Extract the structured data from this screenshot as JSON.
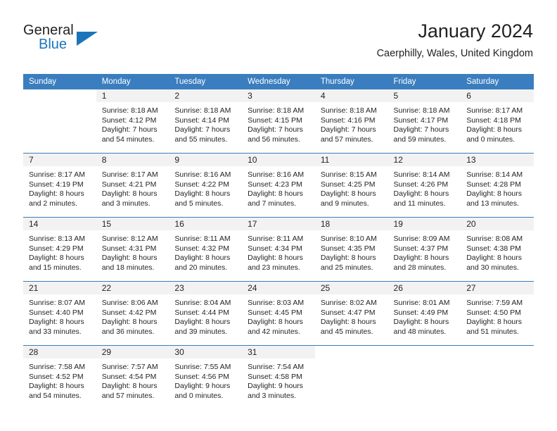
{
  "brand": {
    "name_part1": "General",
    "name_part2": "Blue",
    "accent_color": "#1b75bb"
  },
  "header": {
    "title": "January 2024",
    "subtitle": "Caerphilly, Wales, United Kingdom",
    "header_bg_color": "#3a7ebf",
    "daynum_band_color": "#f2f2f2"
  },
  "weekday_headers": [
    "Sunday",
    "Monday",
    "Tuesday",
    "Wednesday",
    "Thursday",
    "Friday",
    "Saturday"
  ],
  "labels": {
    "sunrise_prefix": "Sunrise:",
    "sunset_prefix": "Sunset:",
    "daylight_prefix": "Daylight:"
  },
  "weeks": [
    [
      {
        "day": "",
        "empty": true,
        "sunrise": "",
        "sunset": "",
        "daylight_line1": "",
        "daylight_line2": ""
      },
      {
        "day": "1",
        "empty": false,
        "sunrise": "Sunrise: 8:18 AM",
        "sunset": "Sunset: 4:12 PM",
        "daylight_line1": "Daylight: 7 hours",
        "daylight_line2": "and 54 minutes."
      },
      {
        "day": "2",
        "empty": false,
        "sunrise": "Sunrise: 8:18 AM",
        "sunset": "Sunset: 4:14 PM",
        "daylight_line1": "Daylight: 7 hours",
        "daylight_line2": "and 55 minutes."
      },
      {
        "day": "3",
        "empty": false,
        "sunrise": "Sunrise: 8:18 AM",
        "sunset": "Sunset: 4:15 PM",
        "daylight_line1": "Daylight: 7 hours",
        "daylight_line2": "and 56 minutes."
      },
      {
        "day": "4",
        "empty": false,
        "sunrise": "Sunrise: 8:18 AM",
        "sunset": "Sunset: 4:16 PM",
        "daylight_line1": "Daylight: 7 hours",
        "daylight_line2": "and 57 minutes."
      },
      {
        "day": "5",
        "empty": false,
        "sunrise": "Sunrise: 8:18 AM",
        "sunset": "Sunset: 4:17 PM",
        "daylight_line1": "Daylight: 7 hours",
        "daylight_line2": "and 59 minutes."
      },
      {
        "day": "6",
        "empty": false,
        "sunrise": "Sunrise: 8:17 AM",
        "sunset": "Sunset: 4:18 PM",
        "daylight_line1": "Daylight: 8 hours",
        "daylight_line2": "and 0 minutes."
      }
    ],
    [
      {
        "day": "7",
        "empty": false,
        "sunrise": "Sunrise: 8:17 AM",
        "sunset": "Sunset: 4:19 PM",
        "daylight_line1": "Daylight: 8 hours",
        "daylight_line2": "and 2 minutes."
      },
      {
        "day": "8",
        "empty": false,
        "sunrise": "Sunrise: 8:17 AM",
        "sunset": "Sunset: 4:21 PM",
        "daylight_line1": "Daylight: 8 hours",
        "daylight_line2": "and 3 minutes."
      },
      {
        "day": "9",
        "empty": false,
        "sunrise": "Sunrise: 8:16 AM",
        "sunset": "Sunset: 4:22 PM",
        "daylight_line1": "Daylight: 8 hours",
        "daylight_line2": "and 5 minutes."
      },
      {
        "day": "10",
        "empty": false,
        "sunrise": "Sunrise: 8:16 AM",
        "sunset": "Sunset: 4:23 PM",
        "daylight_line1": "Daylight: 8 hours",
        "daylight_line2": "and 7 minutes."
      },
      {
        "day": "11",
        "empty": false,
        "sunrise": "Sunrise: 8:15 AM",
        "sunset": "Sunset: 4:25 PM",
        "daylight_line1": "Daylight: 8 hours",
        "daylight_line2": "and 9 minutes."
      },
      {
        "day": "12",
        "empty": false,
        "sunrise": "Sunrise: 8:14 AM",
        "sunset": "Sunset: 4:26 PM",
        "daylight_line1": "Daylight: 8 hours",
        "daylight_line2": "and 11 minutes."
      },
      {
        "day": "13",
        "empty": false,
        "sunrise": "Sunrise: 8:14 AM",
        "sunset": "Sunset: 4:28 PM",
        "daylight_line1": "Daylight: 8 hours",
        "daylight_line2": "and 13 minutes."
      }
    ],
    [
      {
        "day": "14",
        "empty": false,
        "sunrise": "Sunrise: 8:13 AM",
        "sunset": "Sunset: 4:29 PM",
        "daylight_line1": "Daylight: 8 hours",
        "daylight_line2": "and 15 minutes."
      },
      {
        "day": "15",
        "empty": false,
        "sunrise": "Sunrise: 8:12 AM",
        "sunset": "Sunset: 4:31 PM",
        "daylight_line1": "Daylight: 8 hours",
        "daylight_line2": "and 18 minutes."
      },
      {
        "day": "16",
        "empty": false,
        "sunrise": "Sunrise: 8:11 AM",
        "sunset": "Sunset: 4:32 PM",
        "daylight_line1": "Daylight: 8 hours",
        "daylight_line2": "and 20 minutes."
      },
      {
        "day": "17",
        "empty": false,
        "sunrise": "Sunrise: 8:11 AM",
        "sunset": "Sunset: 4:34 PM",
        "daylight_line1": "Daylight: 8 hours",
        "daylight_line2": "and 23 minutes."
      },
      {
        "day": "18",
        "empty": false,
        "sunrise": "Sunrise: 8:10 AM",
        "sunset": "Sunset: 4:35 PM",
        "daylight_line1": "Daylight: 8 hours",
        "daylight_line2": "and 25 minutes."
      },
      {
        "day": "19",
        "empty": false,
        "sunrise": "Sunrise: 8:09 AM",
        "sunset": "Sunset: 4:37 PM",
        "daylight_line1": "Daylight: 8 hours",
        "daylight_line2": "and 28 minutes."
      },
      {
        "day": "20",
        "empty": false,
        "sunrise": "Sunrise: 8:08 AM",
        "sunset": "Sunset: 4:38 PM",
        "daylight_line1": "Daylight: 8 hours",
        "daylight_line2": "and 30 minutes."
      }
    ],
    [
      {
        "day": "21",
        "empty": false,
        "sunrise": "Sunrise: 8:07 AM",
        "sunset": "Sunset: 4:40 PM",
        "daylight_line1": "Daylight: 8 hours",
        "daylight_line2": "and 33 minutes."
      },
      {
        "day": "22",
        "empty": false,
        "sunrise": "Sunrise: 8:06 AM",
        "sunset": "Sunset: 4:42 PM",
        "daylight_line1": "Daylight: 8 hours",
        "daylight_line2": "and 36 minutes."
      },
      {
        "day": "23",
        "empty": false,
        "sunrise": "Sunrise: 8:04 AM",
        "sunset": "Sunset: 4:44 PM",
        "daylight_line1": "Daylight: 8 hours",
        "daylight_line2": "and 39 minutes."
      },
      {
        "day": "24",
        "empty": false,
        "sunrise": "Sunrise: 8:03 AM",
        "sunset": "Sunset: 4:45 PM",
        "daylight_line1": "Daylight: 8 hours",
        "daylight_line2": "and 42 minutes."
      },
      {
        "day": "25",
        "empty": false,
        "sunrise": "Sunrise: 8:02 AM",
        "sunset": "Sunset: 4:47 PM",
        "daylight_line1": "Daylight: 8 hours",
        "daylight_line2": "and 45 minutes."
      },
      {
        "day": "26",
        "empty": false,
        "sunrise": "Sunrise: 8:01 AM",
        "sunset": "Sunset: 4:49 PM",
        "daylight_line1": "Daylight: 8 hours",
        "daylight_line2": "and 48 minutes."
      },
      {
        "day": "27",
        "empty": false,
        "sunrise": "Sunrise: 7:59 AM",
        "sunset": "Sunset: 4:50 PM",
        "daylight_line1": "Daylight: 8 hours",
        "daylight_line2": "and 51 minutes."
      }
    ],
    [
      {
        "day": "28",
        "empty": false,
        "sunrise": "Sunrise: 7:58 AM",
        "sunset": "Sunset: 4:52 PM",
        "daylight_line1": "Daylight: 8 hours",
        "daylight_line2": "and 54 minutes."
      },
      {
        "day": "29",
        "empty": false,
        "sunrise": "Sunrise: 7:57 AM",
        "sunset": "Sunset: 4:54 PM",
        "daylight_line1": "Daylight: 8 hours",
        "daylight_line2": "and 57 minutes."
      },
      {
        "day": "30",
        "empty": false,
        "sunrise": "Sunrise: 7:55 AM",
        "sunset": "Sunset: 4:56 PM",
        "daylight_line1": "Daylight: 9 hours",
        "daylight_line2": "and 0 minutes."
      },
      {
        "day": "31",
        "empty": false,
        "sunrise": "Sunrise: 7:54 AM",
        "sunset": "Sunset: 4:58 PM",
        "daylight_line1": "Daylight: 9 hours",
        "daylight_line2": "and 3 minutes."
      },
      {
        "day": "",
        "empty": true,
        "sunrise": "",
        "sunset": "",
        "daylight_line1": "",
        "daylight_line2": ""
      },
      {
        "day": "",
        "empty": true,
        "sunrise": "",
        "sunset": "",
        "daylight_line1": "",
        "daylight_line2": ""
      },
      {
        "day": "",
        "empty": true,
        "sunrise": "",
        "sunset": "",
        "daylight_line1": "",
        "daylight_line2": ""
      }
    ]
  ]
}
